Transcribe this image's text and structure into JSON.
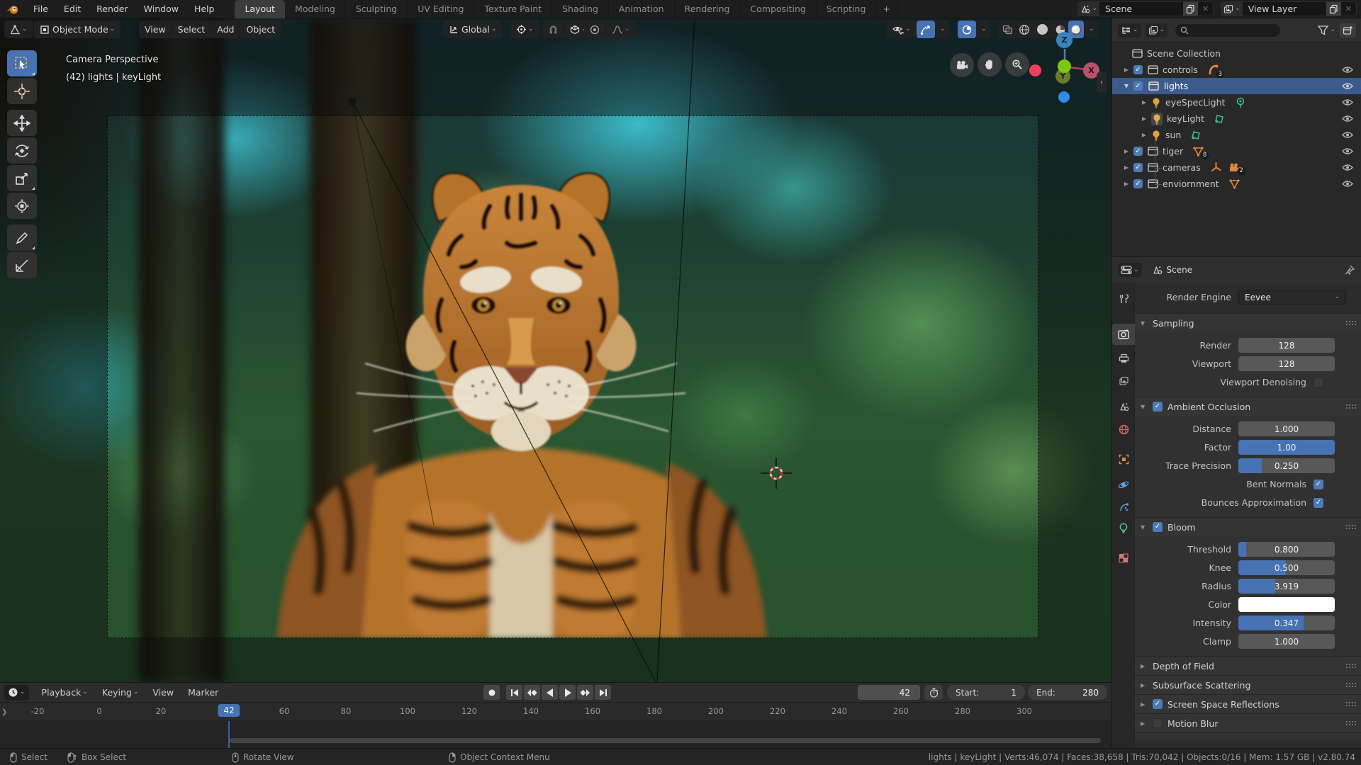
{
  "colors": {
    "accent": "#4772b3",
    "selection": "#3b5b8c",
    "topbar_bg": "#1d1d1d",
    "panel_bg": "#282828"
  },
  "topbar": {
    "menus": [
      "File",
      "Edit",
      "Render",
      "Window",
      "Help"
    ],
    "tabs": [
      "Layout",
      "Modeling",
      "Sculpting",
      "UV Editing",
      "Texture Paint",
      "Shading",
      "Animation",
      "Rendering",
      "Compositing",
      "Scripting"
    ],
    "add_tab": "+",
    "active_tab": "Layout",
    "scene": {
      "value": "Scene"
    },
    "view_layer": {
      "value": "View Layer"
    }
  },
  "viewport": {
    "mode": "Object Mode",
    "menus": [
      "View",
      "Select",
      "Add",
      "Object"
    ],
    "orientation": "Global",
    "overlay": {
      "line1": "Camera Perspective",
      "line2": "(42) lights | keyLight"
    },
    "axis": {
      "x": "X",
      "y": "Y",
      "z": "Z"
    }
  },
  "outliner": {
    "root": "Scene Collection",
    "rows": [
      {
        "label": "controls",
        "badge": "3"
      },
      {
        "label": "lights"
      },
      {
        "label": "eyeSpecLight"
      },
      {
        "label": "keyLight"
      },
      {
        "label": "sun"
      },
      {
        "label": "tiger",
        "badge": "8"
      },
      {
        "label": "cameras",
        "badge": "2"
      },
      {
        "label": "enviornment"
      }
    ]
  },
  "properties": {
    "breadcrumb": "Scene",
    "render_engine": {
      "label": "Render Engine",
      "value": "Eevee"
    },
    "sampling": {
      "title": "Sampling",
      "render_label": "Render",
      "render_value": "128",
      "viewport_label": "Viewport",
      "viewport_value": "128",
      "denoise_label": "Viewport Denoising"
    },
    "ao": {
      "title": "Ambient Occlusion",
      "distance_label": "Distance",
      "distance_value": "1.000",
      "factor_label": "Factor",
      "factor_value": "1.00",
      "trace_label": "Trace Precision",
      "trace_value": "0.250",
      "bent_label": "Bent Normals",
      "bounces_label": "Bounces Approximation"
    },
    "bloom": {
      "title": "Bloom",
      "threshold_label": "Threshold",
      "threshold_value": "0.800",
      "knee_label": "Knee",
      "knee_value": "0.500",
      "radius_label": "Radius",
      "radius_value": "3.919",
      "color_label": "Color",
      "intensity_label": "Intensity",
      "intensity_value": "0.347",
      "clamp_label": "Clamp",
      "clamp_value": "1.000"
    },
    "collapsed": [
      {
        "title": "Depth of Field"
      },
      {
        "title": "Subsurface Scattering"
      },
      {
        "title": "Screen Space Reflections"
      },
      {
        "title": "Motion Blur"
      }
    ]
  },
  "timeline": {
    "menus": [
      "Playback",
      "Keying",
      "View",
      "Marker"
    ],
    "current_frame": "42",
    "frame_field": "42",
    "start_label": "Start:",
    "start_value": "1",
    "end_label": "End:",
    "end_value": "280",
    "ruler": [
      "-20",
      "0",
      "20",
      "60",
      "80",
      "100",
      "120",
      "140",
      "160",
      "180",
      "200",
      "220",
      "240",
      "260",
      "280",
      "300"
    ]
  },
  "statusbar": {
    "hints": [
      "Select",
      "Box Select",
      "Rotate View",
      "Object Context Menu"
    ],
    "info": "lights | keyLight | Verts:46,074 | Faces:38,658 | Tris:70,042 | Objects:0/16 | Mem: 1.57 GB | v2.80.74"
  }
}
